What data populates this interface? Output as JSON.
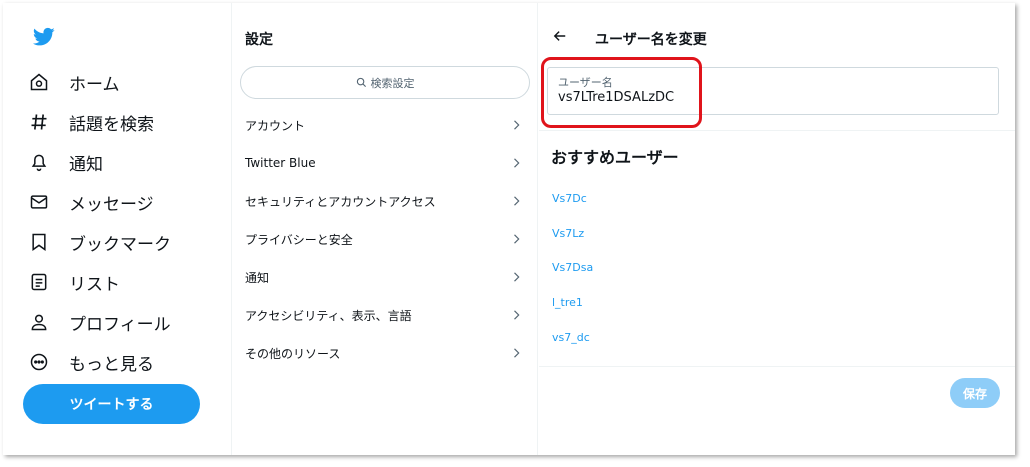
{
  "nav": {
    "items": [
      {
        "icon": "home-icon",
        "label": "ホーム"
      },
      {
        "icon": "hashtag-icon",
        "label": "話題を検索"
      },
      {
        "icon": "bell-icon",
        "label": "通知"
      },
      {
        "icon": "mail-icon",
        "label": "メッセージ"
      },
      {
        "icon": "bookmark-icon",
        "label": "ブックマーク"
      },
      {
        "icon": "list-icon",
        "label": "リスト"
      },
      {
        "icon": "person-icon",
        "label": "プロフィール"
      },
      {
        "icon": "more-icon",
        "label": "もっと見る"
      }
    ],
    "tweet_label": "ツイートする"
  },
  "settings": {
    "title": "設定",
    "search_placeholder": "検索設定",
    "items": [
      {
        "label": "アカウント"
      },
      {
        "label": "Twitter Blue"
      },
      {
        "label": "セキュリティとアカウントアクセス"
      },
      {
        "label": "プライバシーと安全"
      },
      {
        "label": "通知"
      },
      {
        "label": "アクセシビリティ、表示、言語"
      },
      {
        "label": "その他のリソース"
      }
    ]
  },
  "panel": {
    "title": "ユーザー名を変更",
    "field_label": "ユーザー名",
    "field_value": "vs7LTre1DSALzDC",
    "recommend_title": "おすすめユーザー",
    "recommendations": [
      "Vs7Dc",
      "Vs7Lz",
      "Vs7Dsa",
      "l_tre1",
      "vs7_dc"
    ],
    "save_label": "保存"
  },
  "colors": {
    "accent": "#1d9bf0",
    "highlight": "#e0141b",
    "save_disabled": "#8ecdf8"
  }
}
